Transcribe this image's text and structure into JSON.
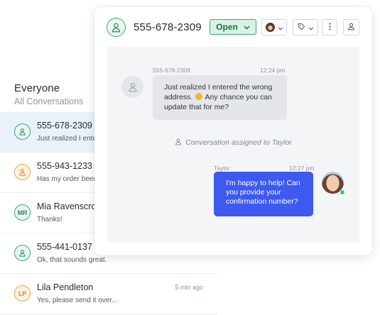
{
  "list": {
    "title": "Everyone",
    "subtitle": "All Conversations",
    "conversations": [
      {
        "name": "555-678-2309",
        "preview": "Just realized I entered",
        "time": "",
        "avatar": "",
        "color": "green",
        "selected": true
      },
      {
        "name": "555-943-1233",
        "preview": "Has my order been",
        "time": "",
        "avatar": "",
        "color": "orange"
      },
      {
        "name": "Mia Ravenscroft",
        "preview": "Thanks!",
        "time": "",
        "avatar": "MR",
        "color": "green"
      },
      {
        "name": "555-441-0137",
        "preview": "Ok, that sounds great.",
        "time": "",
        "avatar": "",
        "color": "green"
      },
      {
        "name": "Lila Pendleton",
        "preview": "Yes, please send it over...",
        "time": "5 min ago",
        "avatar": "LP",
        "color": "orange"
      }
    ]
  },
  "chat": {
    "phone": "555-678-2309",
    "status_label": "Open",
    "incoming": {
      "sender": "555-678-2309",
      "time": "12:24 pm",
      "text_before_emoji": "Just realized I entered the wrong address.",
      "text_after_emoji": "Any chance you can update that for me?"
    },
    "system_message": "Conversation assigned to Taylor",
    "outgoing": {
      "sender": "Taylor",
      "time": "12:27 pm",
      "text": "I'm happy to help! Can you provide your confirmation number?"
    }
  },
  "icons": {
    "contact": "person-outline-icon",
    "status_dropdown": "chevron-down-icon",
    "tag": "tag-icon",
    "more": "vertical-ellipsis-icon",
    "emoji": "grimacing-emoji-icon"
  },
  "colors": {
    "accent_green": "#3aa877",
    "status_bg": "#d8f3e5",
    "outgoing_bubble": "#3d59f0",
    "incoming_bubble": "#e4e6ea",
    "selected_row": "#e9f1fb",
    "orange_avatar": "#f0a640",
    "online": "#37c57a"
  }
}
